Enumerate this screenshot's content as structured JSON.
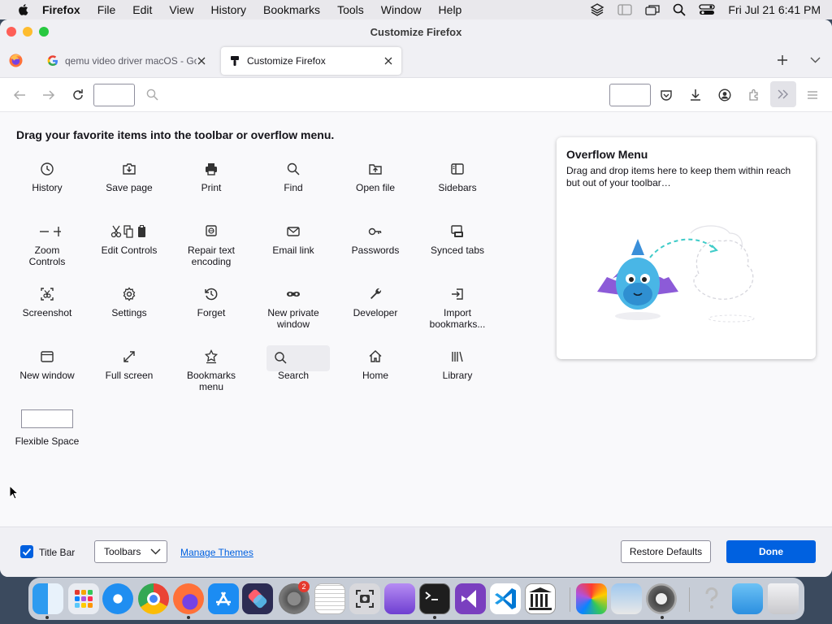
{
  "menubar": {
    "app_name": "Firefox",
    "menus": [
      "File",
      "Edit",
      "View",
      "History",
      "Bookmarks",
      "Tools",
      "Window",
      "Help"
    ],
    "clock": "Fri Jul 21  6:41 PM"
  },
  "window": {
    "title": "Customize Firefox"
  },
  "tabs": [
    {
      "title": "qemu video driver macOS - Goo",
      "active": false
    },
    {
      "title": "Customize Firefox",
      "active": true
    }
  ],
  "instruction": "Drag your favorite items into the toolbar or overflow menu.",
  "palette": [
    {
      "label": "History",
      "icon": "history-icon"
    },
    {
      "label": "Save page",
      "icon": "save-page-icon"
    },
    {
      "label": "Print",
      "icon": "print-icon"
    },
    {
      "label": "Find",
      "icon": "find-icon"
    },
    {
      "label": "Open file",
      "icon": "open-file-icon"
    },
    {
      "label": "Sidebars",
      "icon": "sidebars-icon"
    },
    {
      "label": "Zoom\nControls",
      "icon": "zoom-controls-icon"
    },
    {
      "label": "Edit Controls",
      "icon": "edit-controls-icon"
    },
    {
      "label": "Repair text\nencoding",
      "icon": "repair-text-encoding-icon"
    },
    {
      "label": "Email link",
      "icon": "email-link-icon"
    },
    {
      "label": "Passwords",
      "icon": "passwords-icon"
    },
    {
      "label": "Synced tabs",
      "icon": "synced-tabs-icon"
    },
    {
      "label": "Screenshot",
      "icon": "screenshot-icon"
    },
    {
      "label": "Settings",
      "icon": "settings-icon"
    },
    {
      "label": "Forget",
      "icon": "forget-icon"
    },
    {
      "label": "New private\nwindow",
      "icon": "private-window-icon"
    },
    {
      "label": "Developer",
      "icon": "developer-icon"
    },
    {
      "label": "Import\nbookmarks...",
      "icon": "import-bookmarks-icon"
    },
    {
      "label": "New window",
      "icon": "new-window-icon"
    },
    {
      "label": "Full screen",
      "icon": "full-screen-icon"
    },
    {
      "label": "Bookmarks\nmenu",
      "icon": "bookmarks-menu-icon"
    },
    {
      "label": "Search",
      "icon": "search-icon"
    },
    {
      "label": "Home",
      "icon": "home-icon"
    },
    {
      "label": "Library",
      "icon": "library-icon"
    },
    {
      "label": "Flexible Space",
      "icon": "flexible-space"
    }
  ],
  "overflow_panel": {
    "title": "Overflow Menu",
    "description": "Drag and drop items here to keep them within reach but out of your toolbar…"
  },
  "bottom": {
    "title_bar_label": "Title Bar",
    "title_bar_checked": true,
    "toolbars_label": "Toolbars",
    "manage_themes": "Manage Themes",
    "restore_defaults": "Restore Defaults",
    "done": "Done"
  },
  "dock": {
    "apps": [
      "Finder",
      "Launchpad",
      "Safari",
      "Chrome",
      "Firefox",
      "App Store",
      "Shortcuts",
      "System Preferences",
      "TextEdit",
      "Screenshot",
      "Xcode Simulator",
      "Terminal",
      "Visual Studio",
      "VS Code",
      "Library",
      "Color Picker",
      "Preview",
      "Disk Utility",
      "Help",
      "Folder",
      "Trash"
    ],
    "system_prefs_badge": "2"
  },
  "colors": {
    "accent": "#0061e0",
    "checkbox": "#0060df"
  }
}
